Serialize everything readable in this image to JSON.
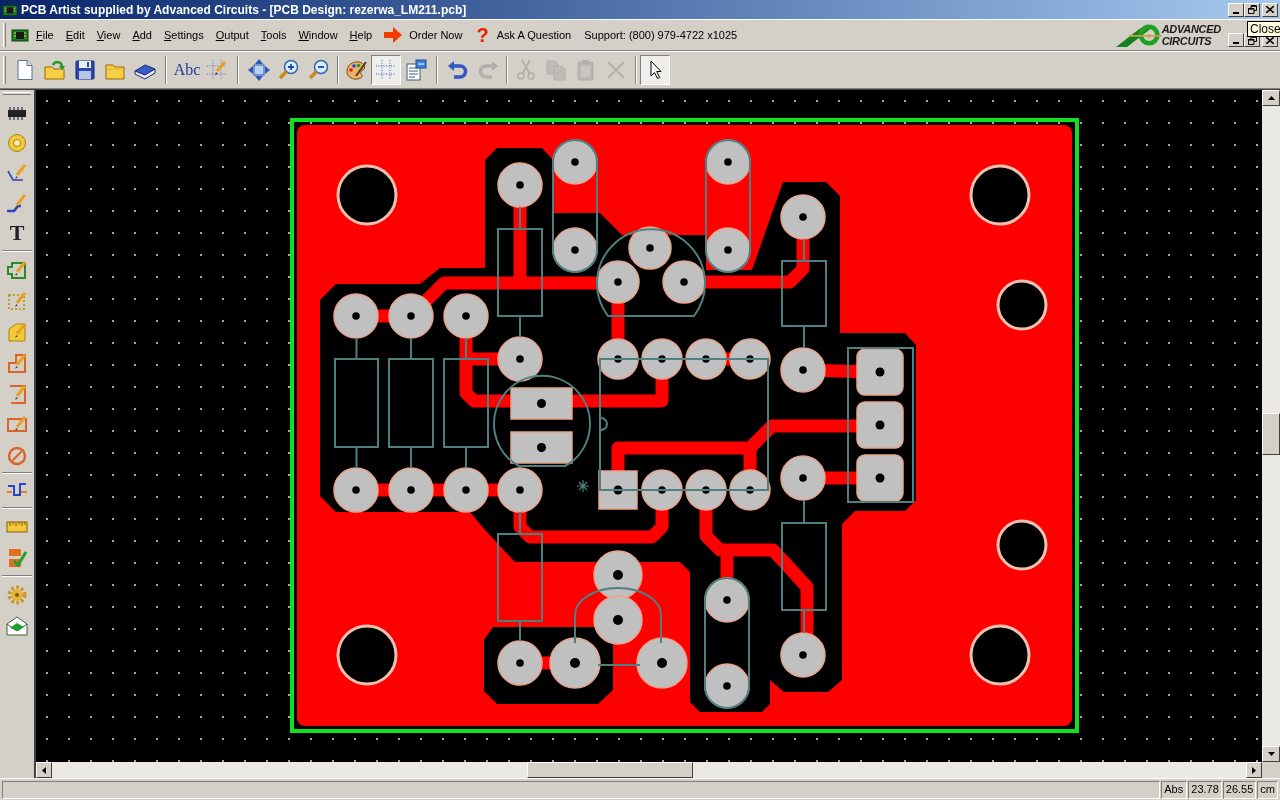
{
  "window": {
    "title": "PCB Artist supplied by Advanced Circuits - [PCB Design: rezerwa_LM211.pcb]"
  },
  "menu_bar": {
    "items": [
      "File",
      "Edit",
      "View",
      "Add",
      "Settings",
      "Output",
      "Tools",
      "Window",
      "Help"
    ],
    "links": [
      {
        "kind": "order",
        "label": "Order Now"
      },
      {
        "kind": "ask",
        "icon": "?",
        "label": "Ask A Question"
      }
    ],
    "support": "Support: (800) 979-4722 x1025"
  },
  "logo": {
    "lines": [
      "ADVANCED",
      "CIRCUITS"
    ]
  },
  "tooltip": {
    "text": "Close"
  },
  "toolbar": {
    "groups": [
      [
        {
          "kind": "new",
          "pressed": false,
          "disabled": false
        },
        {
          "kind": "open",
          "pressed": false,
          "disabled": false
        },
        {
          "kind": "save",
          "pressed": false,
          "disabled": false
        },
        {
          "kind": "folder",
          "pressed": false,
          "disabled": false
        },
        {
          "kind": "book",
          "pressed": false,
          "disabled": false
        }
      ],
      [
        {
          "kind": "spell",
          "label": "Abc",
          "pressed": false,
          "disabled": false
        },
        {
          "kind": "grid-edit",
          "pressed": false,
          "disabled": false
        }
      ],
      [
        {
          "kind": "fit",
          "pressed": false,
          "disabled": false
        },
        {
          "kind": "zoom-in",
          "pressed": false,
          "disabled": false
        },
        {
          "kind": "zoom-out",
          "pressed": false,
          "disabled": false
        }
      ],
      [
        {
          "kind": "palette",
          "pressed": false,
          "disabled": false
        },
        {
          "kind": "grid",
          "pressed": true,
          "disabled": false
        },
        {
          "kind": "properties",
          "pressed": false,
          "disabled": false
        }
      ],
      [
        {
          "kind": "undo",
          "pressed": false,
          "disabled": false
        },
        {
          "kind": "redo",
          "pressed": false,
          "disabled": true
        }
      ],
      [
        {
          "kind": "cut",
          "pressed": false,
          "disabled": true
        },
        {
          "kind": "copy",
          "pressed": false,
          "disabled": true
        },
        {
          "kind": "paste",
          "pressed": false,
          "disabled": true
        },
        {
          "kind": "delete",
          "pressed": false,
          "disabled": true
        }
      ],
      [
        {
          "kind": "select",
          "pressed": true,
          "disabled": false
        }
      ]
    ]
  },
  "tools": {
    "groups": [
      [
        {
          "kind": "component"
        },
        {
          "kind": "pad"
        },
        {
          "kind": "connection"
        },
        {
          "kind": "track"
        },
        {
          "kind": "text",
          "label": "T"
        }
      ],
      [
        {
          "kind": "board"
        },
        {
          "kind": "area"
        },
        {
          "kind": "pour"
        },
        {
          "kind": "shape"
        },
        {
          "kind": "corner"
        },
        {
          "kind": "rectangle"
        },
        {
          "kind": "circle"
        }
      ],
      [
        {
          "kind": "route"
        }
      ],
      [
        {
          "kind": "measure"
        },
        {
          "kind": "check"
        }
      ],
      [
        {
          "kind": "gear"
        },
        {
          "kind": "mail"
        }
      ]
    ]
  },
  "status_bar": {
    "cells": [
      "Abs",
      "23.78",
      "26.55",
      "cm"
    ]
  }
}
